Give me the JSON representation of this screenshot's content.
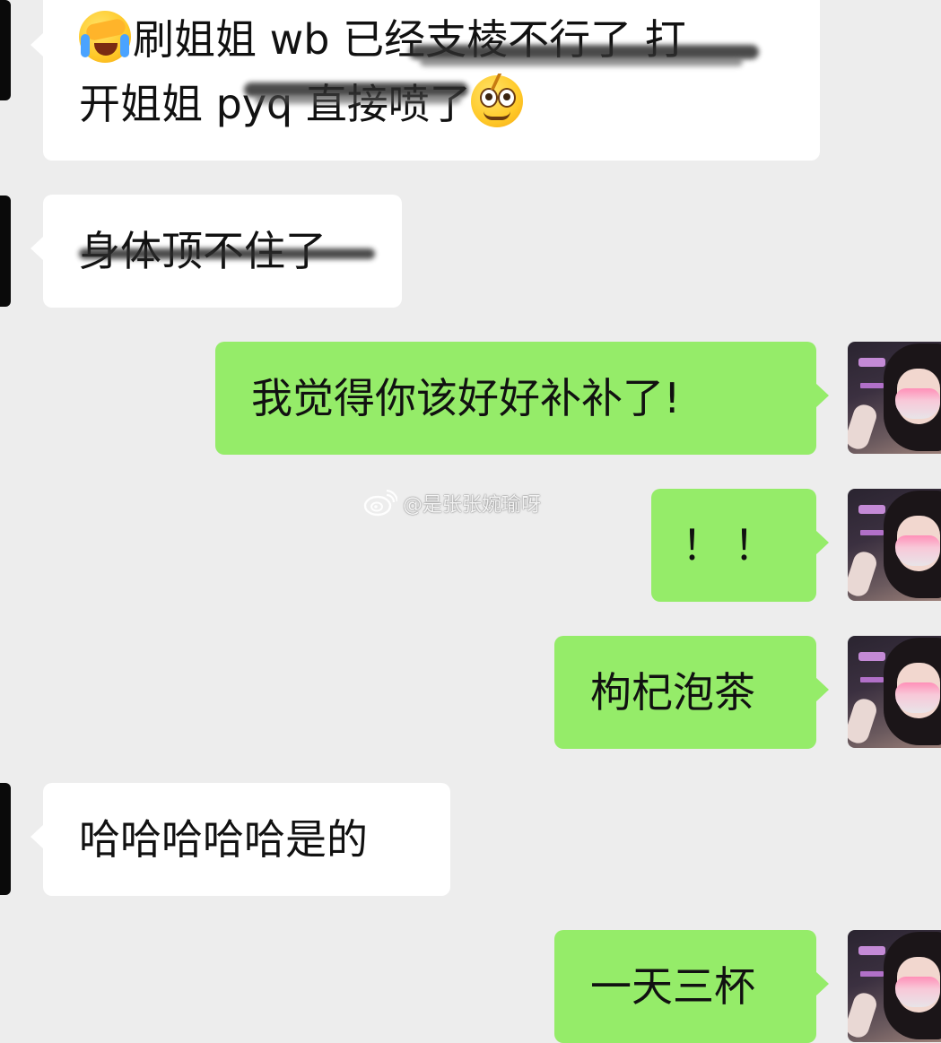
{
  "conversation": {
    "messages": [
      {
        "side": "in",
        "line1_text": "刷姐姐 wb  已经支棱不行了  打",
        "line2_pre": "开姐姐 pyq 直接喷了",
        "emoji_start": "loudly-crying-face-with-hand",
        "emoji_end": "shocked-face"
      },
      {
        "side": "in",
        "text": "身体顶不住了"
      },
      {
        "side": "out",
        "text": "我觉得你该好好补补了!"
      },
      {
        "side": "out",
        "text": "！！"
      },
      {
        "side": "out",
        "text": "枸杞泡茶"
      },
      {
        "side": "in",
        "text": "哈哈哈哈哈是的"
      },
      {
        "side": "out",
        "text": "一天三杯"
      }
    ]
  },
  "watermark": {
    "text": "@是张张婉瑜呀",
    "icon": "weibo-icon"
  },
  "colors": {
    "background": "#ededed",
    "incoming_bubble": "#ffffff",
    "outgoing_bubble": "#95ec69",
    "text": "#111111"
  }
}
